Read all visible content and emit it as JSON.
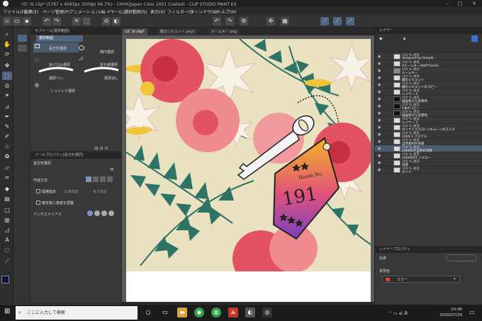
{
  "window": {
    "title": "ﾄﾛﾋﾟｶﾙ.clip* (5787 x 4093px 350dpi 66.7%) - CMYK/Japan Color 2001 Coated) - CLIP STUDIO PAINT EX"
  },
  "menu": [
    "ファイル(F)",
    "編集(E)",
    "ページ管理(P)",
    "アニメーション(A)",
    "レイヤー(L)",
    "選択範囲(S)",
    "表示(V)",
    "フィルター(I)",
    "ウィンドウ(W)",
    "ヘルプ(H)"
  ],
  "subtool_panel": {
    "tab": "サブツール[選択範囲]",
    "header": "選択範囲",
    "items": [
      "長方形選択",
      "楕円選択",
      "投げなわ選択",
      "折れ線選択",
      "選択ペン",
      "選択消し",
      "シュリンク選択"
    ]
  },
  "tool_property": {
    "tab": "ツールプロパティ[長方形選択]",
    "header": "長方形選択",
    "rows": [
      "作成方法",
      "縦横指定",
      "比率指定",
      "長さ指定",
      "確定後に角度を調整",
      "アンチエイリアス"
    ]
  },
  "doc_tabs": [
    "ﾄﾛﾋﾟｶﾙ.clip*",
    "鍵のシルエット.png*",
    "ルームキー.png"
  ],
  "art": {
    "room_label": "Room No.",
    "room_number": "191",
    "colors": {
      "background": "#eae1c0",
      "hibiscus": "#e35263",
      "palm": "#2e7466",
      "tag_top": "#f5b323",
      "tag_bottom": "#7a3fc2"
    }
  },
  "layer_panel": {
    "tab": "レイヤー",
    "layers": [
      {
        "mode": "100 % 通常",
        "name": "designed by freepik"
      },
      {
        "mode": "100 % 通常",
        "name": "Aルームキー(620*1mm)"
      },
      {
        "mode": "100 % 通常",
        "name": "ルームキー"
      },
      {
        "mode": "100 % 通常",
        "name": "鍵のシルエット"
      },
      {
        "mode": "100 % 通常",
        "name": "鍵のシルエットのコピー"
      },
      {
        "mode": "100 % 通常",
        "name": "レイヤー 4"
      },
      {
        "mode": "100 % 通常",
        "name": "描画色から背景色"
      },
      {
        "mode": "100 % 通常",
        "name": "2本のコピー"
      },
      {
        "mode": "100 % 通常",
        "name": "描画色から背景色"
      },
      {
        "mode": "100 % 通常",
        "name": "レイヤー 3"
      },
      {
        "mode": "100 % 通常",
        "name": "ダイナミクス(2) ハネムーンのススメ"
      },
      {
        "mode": "100 % 通常",
        "name": "1000-1 パステル"
      },
      {
        "mode": "100 % 通常",
        "name": "自然素材の背景"
      },
      {
        "mode": "100 % 通常",
        "name": "2000年を自然の背景"
      },
      {
        "mode": "100 % 通常",
        "name": "2000年01 イエロー"
      },
      {
        "mode": "100 % 通常",
        "name": "背景"
      },
      {
        "mode": "100 % 通常",
        "name": "ガイド"
      }
    ]
  },
  "color_panel": {
    "tab": "レイヤープロパティ",
    "effect_label": "効果",
    "display_color_label": "表現色",
    "display_color_value": "カラー"
  },
  "taskbar": {
    "search_placeholder": "ここに入力して検索",
    "time": "20:46",
    "date": "2020/07/29"
  }
}
